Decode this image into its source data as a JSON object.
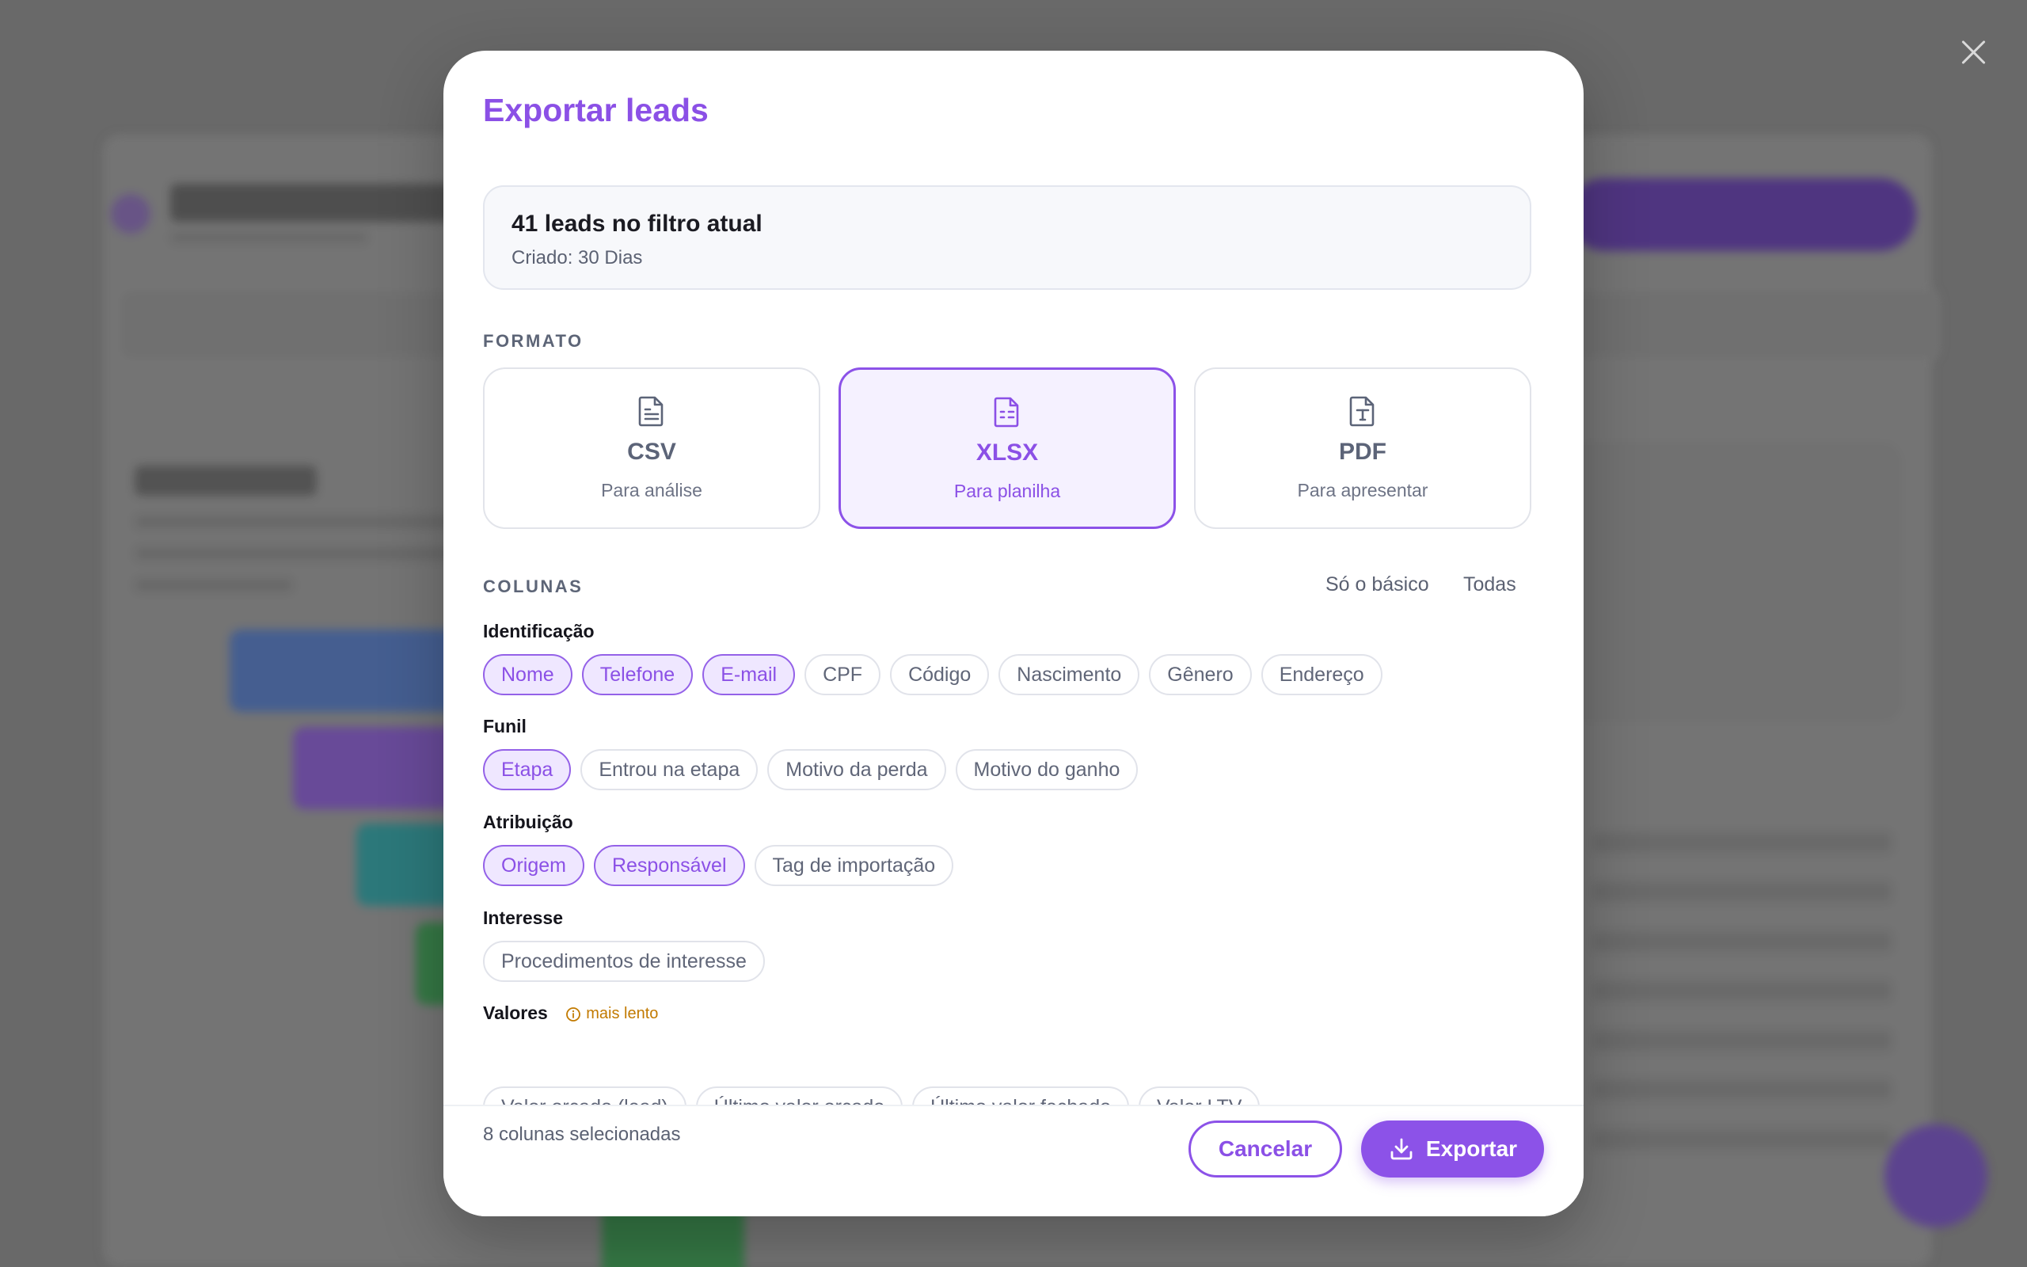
{
  "colors": {
    "accent": "#8b50e6",
    "warning": "#c27a00",
    "text": "#15151c",
    "muted": "#5b6172"
  },
  "modal": {
    "title": "Exportar leads",
    "summary": {
      "count": "41 leads no filtro atual",
      "filter": "Criado: 30 Dias"
    },
    "format_label": "FORMATO",
    "formats": [
      {
        "name": "CSV",
        "desc": "Para análise",
        "icon": "file-text-icon",
        "selected": false
      },
      {
        "name": "XLSX",
        "desc": "Para planilha",
        "icon": "file-spreadsheet-icon",
        "selected": true
      },
      {
        "name": "PDF",
        "desc": "Para apresentar",
        "icon": "file-type-icon",
        "selected": false
      }
    ],
    "columns_label": "COLUNAS",
    "columns_actions": {
      "basic": "Só o básico",
      "all": "Todas"
    },
    "groups": [
      {
        "label": "Identificação",
        "chips": [
          {
            "label": "Nome",
            "selected": true
          },
          {
            "label": "Telefone",
            "selected": true
          },
          {
            "label": "E-mail",
            "selected": true
          },
          {
            "label": "CPF",
            "selected": false
          },
          {
            "label": "Código",
            "selected": false
          },
          {
            "label": "Nascimento",
            "selected": false
          },
          {
            "label": "Gênero",
            "selected": false
          },
          {
            "label": "Endereço",
            "selected": false
          }
        ]
      },
      {
        "label": "Funil",
        "chips": [
          {
            "label": "Etapa",
            "selected": true
          },
          {
            "label": "Entrou na etapa",
            "selected": false
          },
          {
            "label": "Motivo da perda",
            "selected": false
          },
          {
            "label": "Motivo do ganho",
            "selected": false
          }
        ]
      },
      {
        "label": "Atribuição",
        "chips": [
          {
            "label": "Origem",
            "selected": true
          },
          {
            "label": "Responsável",
            "selected": true
          },
          {
            "label": "Tag de importação",
            "selected": false
          }
        ]
      },
      {
        "label": "Interesse",
        "chips": [
          {
            "label": "Procedimentos de interesse",
            "selected": false
          }
        ]
      },
      {
        "label": "Valores",
        "badge": "mais lento",
        "chips": [
          {
            "label": "Valor orçado (lead)",
            "selected": false
          },
          {
            "label": "Último valor orçado",
            "selected": false
          },
          {
            "label": "Último valor fechado",
            "selected": false
          },
          {
            "label": "Valor LTV",
            "selected": false
          }
        ]
      }
    ],
    "footer": {
      "selected_count": "8 colunas selecionadas",
      "cancel": "Cancelar",
      "export": "Exportar"
    }
  }
}
